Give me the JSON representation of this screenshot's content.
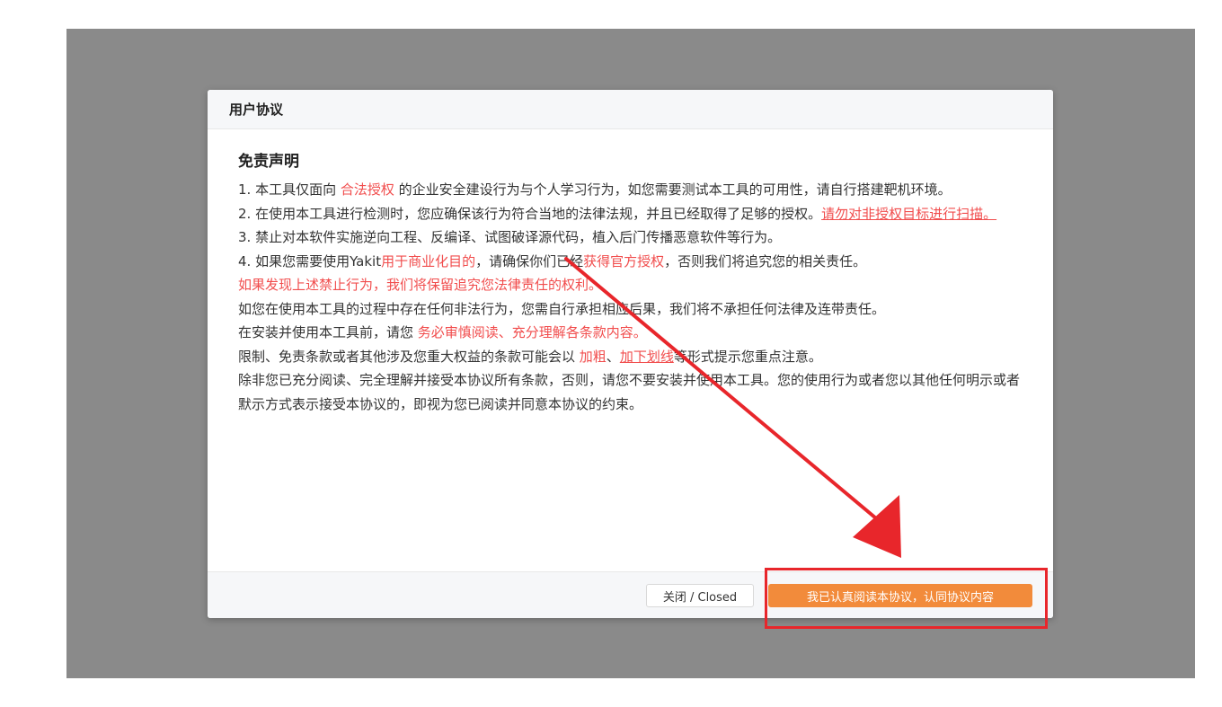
{
  "dialog": {
    "title": "用户协议",
    "heading": "免责声明",
    "p1": {
      "a": "1. 本工具仅面向 ",
      "b": "合法授权",
      "c": " 的企业安全建设行为与个人学习行为，如您需要测试本工具的可用性，请自行搭建靶机环境。"
    },
    "p2": {
      "a": "2. 在使用本工具进行检测时，您应确保该行为符合当地的法律法规，并且已经取得了足够的授权。",
      "b": "请勿对非授权目标进行扫描。"
    },
    "p3": "3. 禁止对本软件实施逆向工程、反编译、试图破译源代码，植入后门传播恶意软件等行为。",
    "p4": {
      "a": "4. 如果您需要使用Yakit",
      "b": "用于商业化目的",
      "c": "，请确保你们已经",
      "d": "获得官方授权",
      "e": "，否则我们将追究您的相关责任。"
    },
    "p5": "如果发现上述禁止行为，我们将保留追究您法律责任的权利。",
    "p6": "如您在使用本工具的过程中存在任何非法行为，您需自行承担相应后果，我们将不承担任何法律及连带责任。",
    "p7": {
      "a": "在安装并使用本工具前，请您 ",
      "b": "务必审慎阅读、充分理解各条款内容。"
    },
    "p8": {
      "a": "限制、免责条款或者其他涉及您重大权益的条款可能会以 ",
      "b": "加粗",
      "c": "、",
      "d": "加下划线",
      "e": "等形式提示您重点注意。"
    },
    "p9": "除非您已充分阅读、完全理解并接受本协议所有条款，否则，请您不要安装并使用本工具。您的使用行为或者您以其他任何明示或者默示方式表示接受本协议的，即视为您已阅读并同意本协议的约束。",
    "close_label": "关闭 / Closed",
    "accept_label": "我已认真阅读本协议，认同协议内容"
  },
  "colors": {
    "accent": "#f28b3b",
    "warning_text": "#f14d4d",
    "annotation": "#e8262b",
    "overlay": "#8a8a8a"
  }
}
